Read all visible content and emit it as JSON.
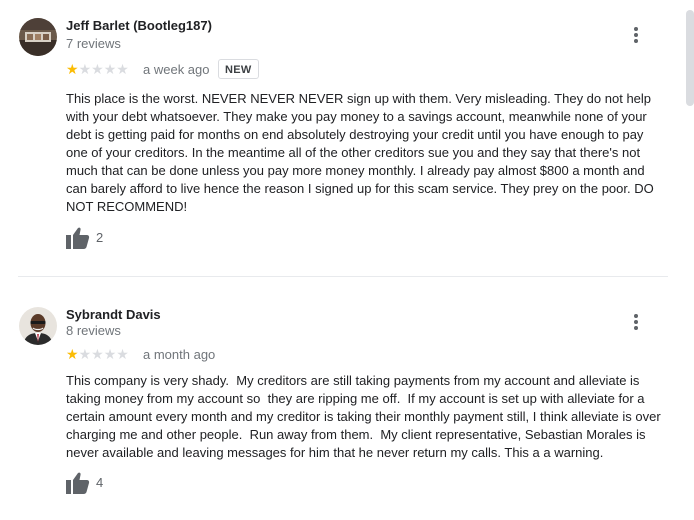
{
  "reviews": [
    {
      "author": "Jeff Barlet (Bootleg187)",
      "review_count": "7 reviews",
      "rating": 1,
      "max_rating": 5,
      "date": "a week ago",
      "badge": "NEW",
      "text": "This place is the worst. NEVER NEVER NEVER sign up with them. Very misleading. They do not help\nwith your debt whatsoever. They make you pay money to a savings account, meanwhile none of your\ndebt is getting paid for months on end absolutely destroying your credit until you have enough to pay\none of your creditors. In the meantime all of the other creditors sue you and they say that there's not\nmuch that can be done unless you pay more money monthly. I already pay almost $800 a month and\ncan barely afford to live hence the reason I signed up for this scam service. They prey on the poor. DO\nNOT RECOMMEND!",
      "likes": "2"
    },
    {
      "author": "Sybrandt Davis",
      "review_count": "8 reviews",
      "rating": 1,
      "max_rating": 5,
      "date": "a month ago",
      "text": "This company is very shady.  My creditors are still taking payments from my account and alleviate is\ntaking money from my account so  they are ripping me off.  If my account is set up with alleviate for a\ncertain amount every month and my creditor is taking their monthly payment still, I think alleviate is over\ncharging me and other people.  Run away from them.  My client representative, Sebastian Morales is\nnever available and leaving messages for him that he never return my calls. This a a warning.",
      "likes": "4"
    }
  ],
  "colors": {
    "star_filled": "#fbbc04",
    "star_empty": "#dadce0",
    "secondary_text": "#70757a",
    "divider": "#e8eaed"
  },
  "icons": {
    "menu": "more-vert-icon",
    "like": "thumb-up-icon",
    "star": "star-icon"
  }
}
